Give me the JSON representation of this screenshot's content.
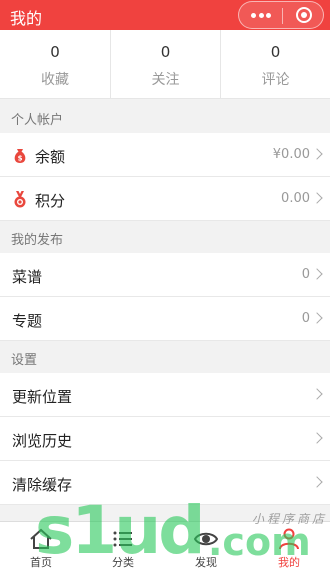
{
  "header": {
    "title": "我的"
  },
  "stats": [
    {
      "value": "0",
      "label": "收藏"
    },
    {
      "value": "0",
      "label": "关注"
    },
    {
      "value": "0",
      "label": "评论"
    }
  ],
  "account": {
    "title": "个人帐户",
    "items": [
      {
        "label": "余额",
        "value": "¥0.00",
        "icon": "money-bag-icon"
      },
      {
        "label": "积分",
        "value": "0.00",
        "icon": "medal-icon"
      }
    ]
  },
  "publish": {
    "title": "我的发布",
    "items": [
      {
        "label": "菜谱",
        "value": "0"
      },
      {
        "label": "专题",
        "value": "0"
      }
    ]
  },
  "settings": {
    "title": "设置",
    "items": [
      {
        "label": "更新位置"
      },
      {
        "label": "浏览历史"
      },
      {
        "label": "清除缓存"
      }
    ]
  },
  "tabbar": [
    {
      "label": "首页",
      "icon": "home-icon"
    },
    {
      "label": "分类",
      "icon": "list-icon"
    },
    {
      "label": "发现",
      "icon": "eye-icon"
    },
    {
      "label": "我的",
      "icon": "person-icon"
    }
  ],
  "watermark": {
    "brand": "s1ud",
    "domain": ".com",
    "slogan": "小程序商店"
  },
  "colors": {
    "accent": "#f0423f",
    "watermark": "#28c85a"
  }
}
